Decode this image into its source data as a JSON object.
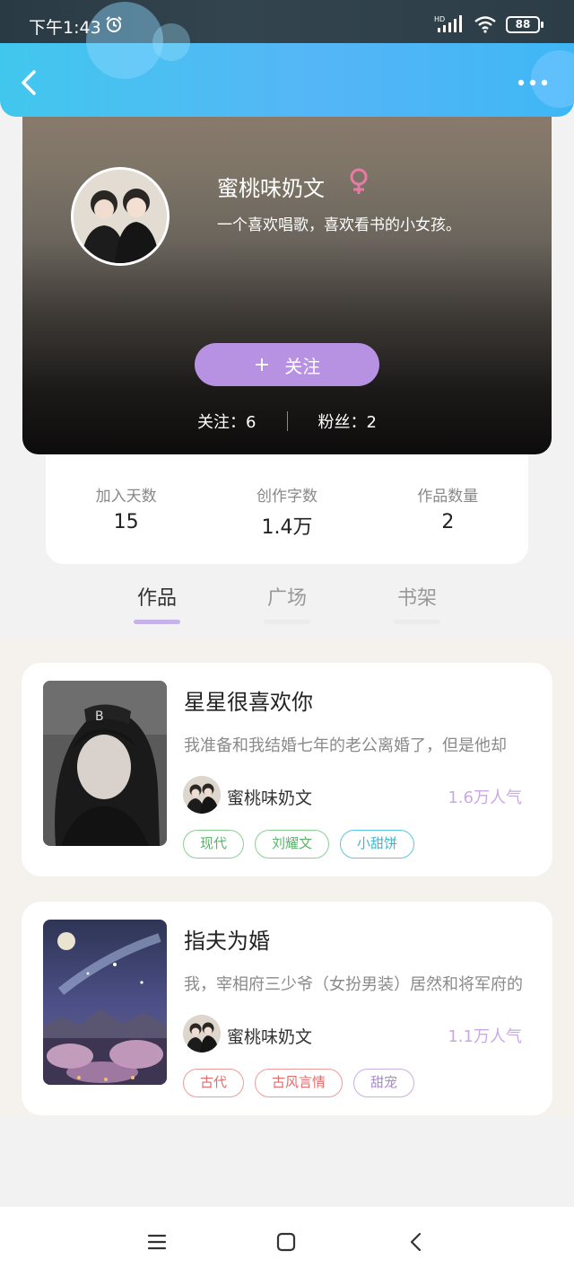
{
  "status_bar": {
    "time": "下午1:43",
    "network": "HD",
    "battery": "88"
  },
  "colors": {
    "nav_gradient": "#41c7ee",
    "accent_purple": "#b892e2",
    "female_icon": "#e77ba6",
    "popularity": "#c9a8e8"
  },
  "profile": {
    "name": "蜜桃味奶文",
    "gender_icon": "female-icon",
    "bio": "一个喜欢唱歌，喜欢看书的小女孩。",
    "follow_plus": "+",
    "follow_label": "关注",
    "following": "关注：6",
    "followers": "粉丝：2"
  },
  "stats": [
    {
      "label": "加入天数",
      "value": "15"
    },
    {
      "label": "创作字数",
      "value": "1.4万"
    },
    {
      "label": "作品数量",
      "value": "2"
    }
  ],
  "tabs": [
    {
      "label": "作品",
      "active": true
    },
    {
      "label": "广场",
      "active": false
    },
    {
      "label": "书架",
      "active": false
    }
  ],
  "works": [
    {
      "title": "星星很喜欢你",
      "description": "我准备和我结婚七年的老公离婚了，但是他却",
      "author": "蜜桃味奶文",
      "popularity": "1.6万人气",
      "tags": [
        "现代",
        "刘耀文",
        "小甜饼"
      ]
    },
    {
      "title": "指夫为婚",
      "description": "我，宰相府三少爷（女扮男装）居然和将军府的",
      "author": "蜜桃味奶文",
      "popularity": "1.1万人气",
      "tags": [
        "古代",
        "古风言情",
        "甜宠"
      ]
    }
  ],
  "nav": {
    "back_icon": "chevron-left-icon",
    "more_icon": "more-dots-icon",
    "system_buttons": [
      "menu-icon",
      "home-icon",
      "back-icon"
    ]
  }
}
